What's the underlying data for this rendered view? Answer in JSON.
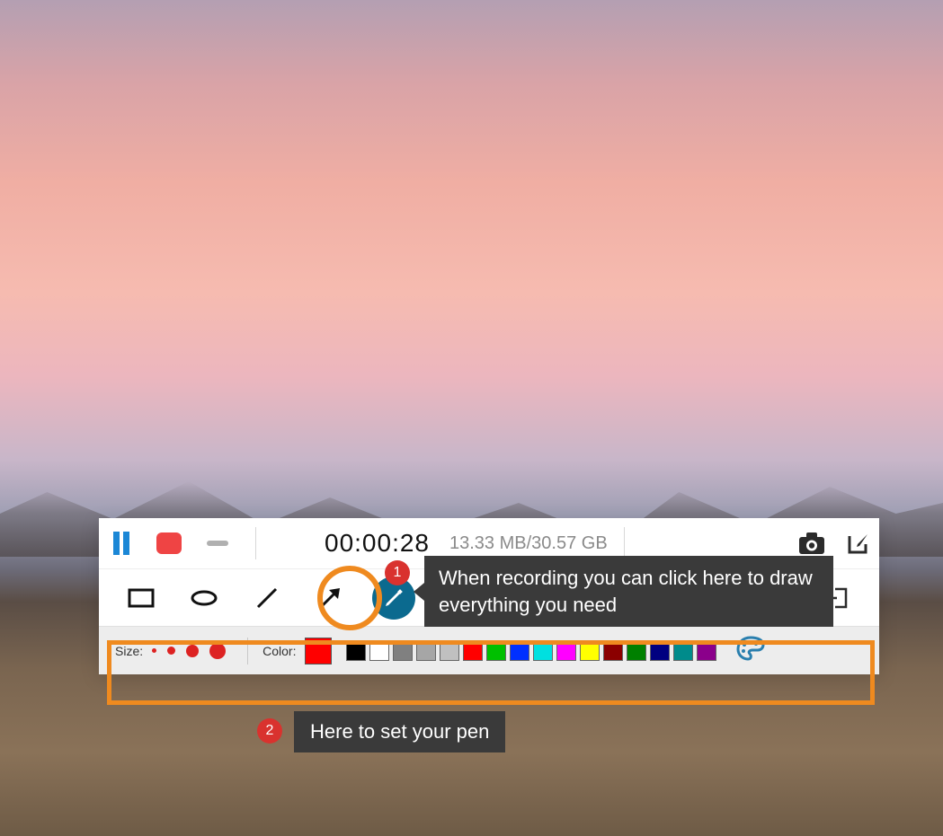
{
  "recorder": {
    "timer": "00:00:28",
    "filesize": "13.33 MB/30.57 GB"
  },
  "settings": {
    "size_label": "Size:",
    "color_label": "Color:",
    "current_color": "#ff0000",
    "swatches": [
      "#000000",
      "#ffffff",
      "#808080",
      "#a6a6a6",
      "#c0c0c0",
      "#ff0000",
      "#00c000",
      "#0030ff",
      "#00e0e0",
      "#ff00ff",
      "#ffff00",
      "#8b0000",
      "#008000",
      "#000080",
      "#008b8b",
      "#8b008b"
    ]
  },
  "annotations": {
    "c1_num": "1",
    "c1_text": "When recording you can click here to draw everything you need",
    "c2_num": "2",
    "c2_text": "Here to set your pen"
  }
}
